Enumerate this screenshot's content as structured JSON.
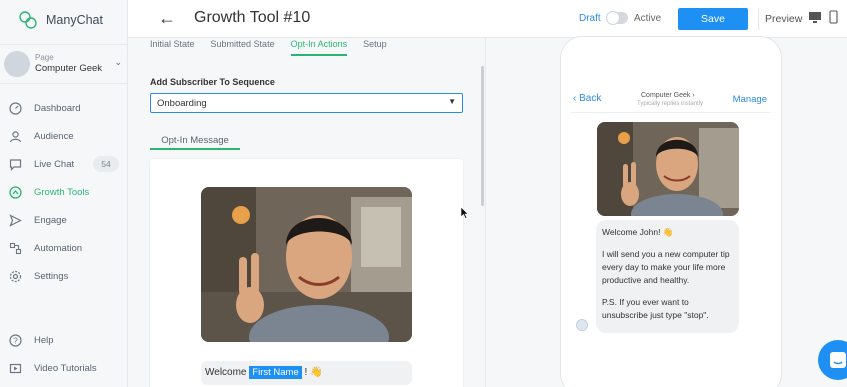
{
  "brand": {
    "name": "ManyChat",
    "color": "#2bb673"
  },
  "page_selector": {
    "label": "Page",
    "name": "Computer Geek"
  },
  "nav": [
    {
      "label": "Dashboard",
      "icon": "dashboard-icon"
    },
    {
      "label": "Audience",
      "icon": "user-icon"
    },
    {
      "label": "Live Chat",
      "icon": "chat-icon",
      "count": "54"
    },
    {
      "label": "Growth Tools",
      "icon": "growth-tools-icon",
      "active": true
    },
    {
      "label": "Engage",
      "icon": "send-icon"
    },
    {
      "label": "Automation",
      "icon": "automation-icon"
    },
    {
      "label": "Settings",
      "icon": "gear-icon"
    }
  ],
  "nav_bottom": [
    {
      "label": "Help",
      "icon": "help-icon"
    },
    {
      "label": "Video Tutorials",
      "icon": "video-icon"
    }
  ],
  "header": {
    "title": "Growth Tool #10",
    "status_draft": "Draft",
    "status_active": "Active",
    "save_label": "Save",
    "preview_label": "Preview"
  },
  "tabs": [
    {
      "label": "Initial State"
    },
    {
      "label": "Submitted State"
    },
    {
      "label": "Opt-In Actions",
      "active": true
    },
    {
      "label": "Setup"
    }
  ],
  "sequence": {
    "label": "Add Subscriber To Sequence",
    "value": "Onboarding"
  },
  "optin_message": {
    "tab_label": "Opt-In Message",
    "welcome_prefix": "Welcome",
    "first_name_chip": "First Name",
    "welcome_suffix": "! 👋"
  },
  "chat_preview": {
    "back_label": "Back",
    "page_name": "Computer Geek",
    "subtitle": "Typically replies instantly",
    "manage_label": "Manage",
    "bubble_lines": [
      "Welcome John! 👋",
      "I will send you a new computer tip every day to make your life more productive and healthy.",
      "P.S. If you ever want to unsubscribe just type \"stop\"."
    ]
  },
  "colors": {
    "accent": "#2bb673",
    "primary": "#1e8ff3"
  }
}
